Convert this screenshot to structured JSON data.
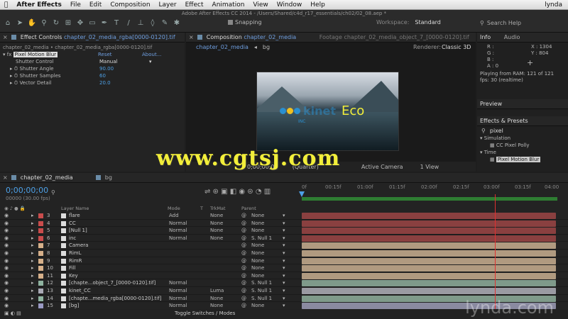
{
  "menubar": {
    "apple": "",
    "app_name": "After Effects",
    "items": [
      "File",
      "Edit",
      "Composition",
      "Layer",
      "Effect",
      "Animation",
      "View",
      "Window",
      "Help"
    ],
    "user": "lynda"
  },
  "window_title": "Adobe After Effects CC 2014 - /Users/Shared/c4d_r17_essentials/ch02/02_08.aep *",
  "toolbar": {
    "snapping": "Snapping",
    "workspace_label": "Workspace:",
    "workspace_value": "Standard",
    "search_placeholder": "Search Help"
  },
  "effect_controls": {
    "tab_label": "Effect Controls",
    "tab_file": "chapter_02_media_rgba[0000-0120].tif",
    "breadcrumb": "chapter_02_media • chapter_02_media_rgba[0000-0120].tif",
    "effect_name": "Pixel Motion Blur",
    "reset": "Reset",
    "about": "About...",
    "props": [
      {
        "label": "Shutter Control",
        "value": "Manual"
      },
      {
        "label": "Shutter Angle",
        "value": "90.00"
      },
      {
        "label": "Shutter Samples",
        "value": "60"
      },
      {
        "label": "Vector Detail",
        "value": "20.0"
      }
    ]
  },
  "composition": {
    "tab_label": "Composition",
    "tab_name": "chapter_02_media",
    "footage_tab": "Footage chapter_02_media_object_7_[0000-0120].tif",
    "crumb_comp": "chapter_02_media",
    "crumb_bg": "bg",
    "renderer_label": "Renderer:",
    "renderer_value": "Classic 3D",
    "preview_text": "Eco",
    "preview_logo": "kinet",
    "preview_sub": "INC",
    "view_select": "1 View",
    "timecode": "0;00;00;00",
    "quality": "(Quarter)",
    "active_camera": "Active Camera"
  },
  "info": {
    "tab_info": "Info",
    "tab_audio": "Audio",
    "r": "R :",
    "g": "G :",
    "b": "B :",
    "a": "A : 0",
    "x": "X : 1304",
    "y": "Y : 804",
    "ram": "Playing from RAM: 121 of 121",
    "fps": "fps: 30 (realtime)"
  },
  "preview_panel": {
    "label": "Preview"
  },
  "effects_presets": {
    "label": "Effects & Presets",
    "search": "pixel",
    "items": [
      {
        "label": "Simulation",
        "kind": "group"
      },
      {
        "label": "CC Pixel Polly",
        "kind": "item"
      },
      {
        "label": "Time",
        "kind": "group"
      },
      {
        "label": "Pixel Motion Blur",
        "kind": "item-selected"
      }
    ]
  },
  "timeline": {
    "tab_comp": "chapter_02_media",
    "tab_bg": "bg",
    "timecode": "0;00;00;00",
    "frames": "00000 (30.00 fps)",
    "col_layer": "Layer Name",
    "col_mode": "Mode",
    "col_t": "T",
    "col_trkmat": "TrkMat",
    "col_parent": "Parent",
    "ruler": [
      "0f",
      "00:15f",
      "01:00f",
      "01:15f",
      "02:00f",
      "02:15f",
      "03:00f",
      "03:15f",
      "04:00"
    ],
    "footer": "Toggle Switches / Modes",
    "layers": [
      {
        "num": "3",
        "name": "flare",
        "mode": "Add",
        "trk": "None",
        "parent": "None",
        "color": "#8a4040",
        "label": "#c94c4c"
      },
      {
        "num": "4",
        "name": "CC",
        "mode": "Normal",
        "trk": "None",
        "parent": "None",
        "color": "#8a4040",
        "label": "#c94c4c"
      },
      {
        "num": "5",
        "name": "[Null 1]",
        "mode": "Normal",
        "trk": "None",
        "parent": "None",
        "color": "#8a4040",
        "label": "#c94c4c"
      },
      {
        "num": "6",
        "name": "inc",
        "mode": "Normal",
        "trk": "None",
        "parent": "S. Null 1",
        "color": "#8a4040",
        "label": "#c94c4c"
      },
      {
        "num": "7",
        "name": "Camera",
        "mode": "",
        "trk": "",
        "parent": "None",
        "color": "#b09a80",
        "label": "#d6b08a"
      },
      {
        "num": "8",
        "name": "RimL",
        "mode": "",
        "trk": "",
        "parent": "None",
        "color": "#b09a80",
        "label": "#d6b08a"
      },
      {
        "num": "9",
        "name": "RimR",
        "mode": "",
        "trk": "",
        "parent": "None",
        "color": "#b09a80",
        "label": "#d6b08a"
      },
      {
        "num": "10",
        "name": "Fill",
        "mode": "",
        "trk": "",
        "parent": "None",
        "color": "#b09a80",
        "label": "#d6b08a"
      },
      {
        "num": "11",
        "name": "Key",
        "mode": "",
        "trk": "",
        "parent": "None",
        "color": "#b09a80",
        "label": "#d6b08a"
      },
      {
        "num": "12",
        "name": "[chapte...object_7_[0000-0120].tif]",
        "mode": "Normal",
        "trk": "",
        "parent": "S. Null 1",
        "color": "#7f9a8a",
        "label": "#8fb3a0"
      },
      {
        "num": "13",
        "name": "kinet_CC",
        "mode": "Normal",
        "trk": "Luma",
        "parent": "S. Null 1",
        "color": "#9a9aa2",
        "label": "#a9a9b5"
      },
      {
        "num": "14",
        "name": "[chapte...media_rgba[0000-0120].tif]",
        "mode": "Normal",
        "trk": "None",
        "parent": "S. Null 1",
        "color": "#7f9a8a",
        "label": "#8fb3a0"
      },
      {
        "num": "15",
        "name": "[bg]",
        "mode": "Normal",
        "trk": "None",
        "parent": "None",
        "color": "#8a8aa0",
        "label": "#9a9ac4"
      }
    ]
  },
  "watermark": "www.cgtsj.com",
  "brand": "lynda.com"
}
